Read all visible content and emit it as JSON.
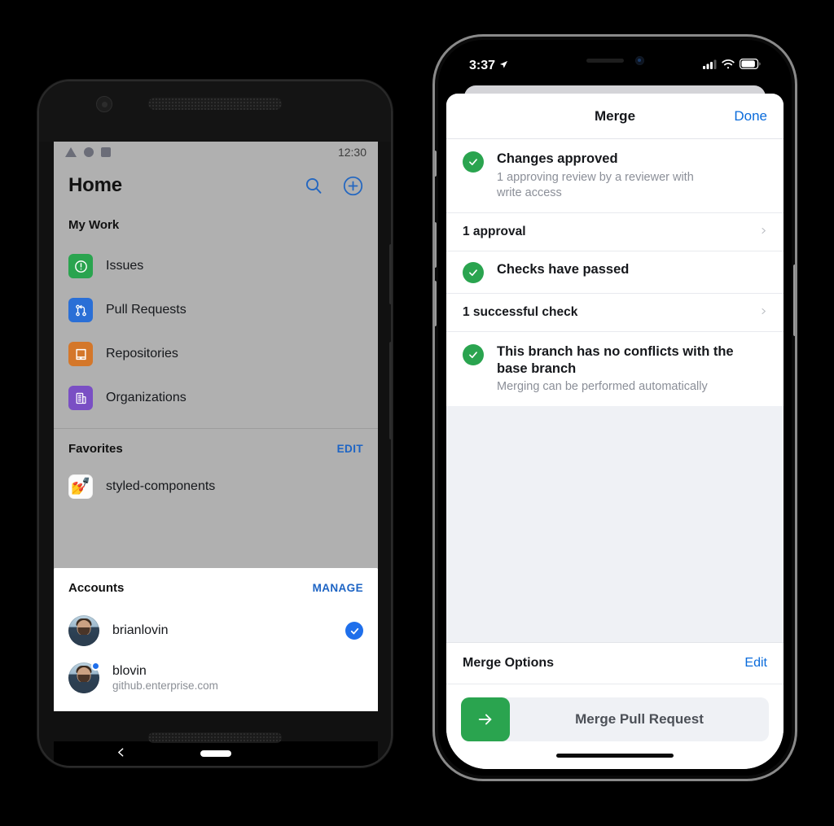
{
  "android": {
    "status_bar": {
      "time": "12:30",
      "icons": [
        "triangle-icon",
        "circle-icon",
        "square-icon"
      ]
    },
    "header": {
      "title": "Home",
      "search_icon": "search-icon",
      "add_icon": "plus-circle-icon"
    },
    "my_work": {
      "title": "My Work",
      "items": [
        {
          "label": "Issues",
          "icon": "issue-opened-icon",
          "color": "#2aa44f"
        },
        {
          "label": "Pull Requests",
          "icon": "git-pull-request-icon",
          "color": "#2a6fd6"
        },
        {
          "label": "Repositories",
          "icon": "repo-icon",
          "color": "#d4772a"
        },
        {
          "label": "Organizations",
          "icon": "organization-icon",
          "color": "#7a4fc4"
        }
      ]
    },
    "favorites": {
      "title": "Favorites",
      "action": "EDIT",
      "items": [
        {
          "label": "styled-components",
          "emoji": "💅"
        }
      ]
    },
    "accounts": {
      "title": "Accounts",
      "action": "MANAGE",
      "items": [
        {
          "name": "brianlovin",
          "host": "",
          "selected": true,
          "badge": false
        },
        {
          "name": "blovin",
          "host": "github.enterprise.com",
          "selected": false,
          "badge": true
        }
      ]
    },
    "navbar": {
      "back_icon": "chevron-left-icon",
      "home_pill": "home-pill"
    }
  },
  "ios": {
    "status_bar": {
      "time": "3:37",
      "location_icon": "location-arrow-icon",
      "cellular_icon": "cellular-bars-icon",
      "wifi_icon": "wifi-icon",
      "battery_icon": "battery-icon"
    },
    "sheet": {
      "title": "Merge",
      "done_label": "Done",
      "checks": [
        {
          "title": "Changes approved",
          "subtitle": "1 approving review by a reviewer with write access",
          "icon": "check-circle-icon",
          "color": "#2aa44f"
        },
        {
          "title": "Checks have passed",
          "subtitle": "",
          "icon": "check-circle-icon",
          "color": "#2aa44f"
        },
        {
          "title": "This branch has no conflicts with the base branch",
          "subtitle": "Merging can be performed automatically",
          "icon": "check-circle-icon",
          "color": "#2aa44f"
        }
      ],
      "links": [
        {
          "label": "1 approval",
          "chevron": "chevron-right-icon"
        },
        {
          "label": "1 successful check",
          "chevron": "chevron-right-icon"
        }
      ],
      "merge_options": {
        "title": "Merge Options",
        "edit_label": "Edit",
        "button_label": "Merge Pull Request",
        "button_icon": "arrow-right-icon",
        "button_color": "#2aa44f"
      }
    }
  },
  "theme": {
    "accent_blue": "#0a6bdb",
    "android_blue": "#1d64c4",
    "success_green": "#2aa44f",
    "ios_bg": "#eff1f5",
    "android_bg": "#b0b0b0"
  }
}
